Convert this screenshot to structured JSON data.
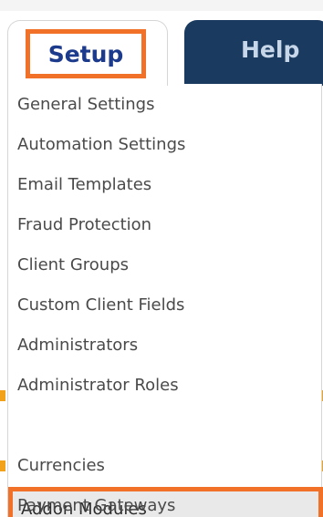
{
  "nav": {
    "tabs": [
      {
        "label": "Setup",
        "active": true
      },
      {
        "label": "Help",
        "active": false
      }
    ]
  },
  "menu": {
    "items": [
      {
        "label": "General Settings"
      },
      {
        "label": "Automation Settings"
      },
      {
        "label": "Email Templates"
      },
      {
        "label": "Fraud Protection"
      },
      {
        "label": "Client Groups"
      },
      {
        "label": "Custom Client Fields"
      },
      {
        "label": "Administrators"
      },
      {
        "label": "Administrator Roles"
      },
      {
        "label": "Addon Modules",
        "highlighted": true
      },
      {
        "label": "Currencies"
      },
      {
        "label": "Payment Gateways"
      }
    ]
  },
  "colors": {
    "highlight_border": "#f27128",
    "tab_dark": "#1a3a5f",
    "setup_text": "#1d3b8c",
    "help_text": "#c7d6e8",
    "menu_text": "#4a4a4a"
  }
}
